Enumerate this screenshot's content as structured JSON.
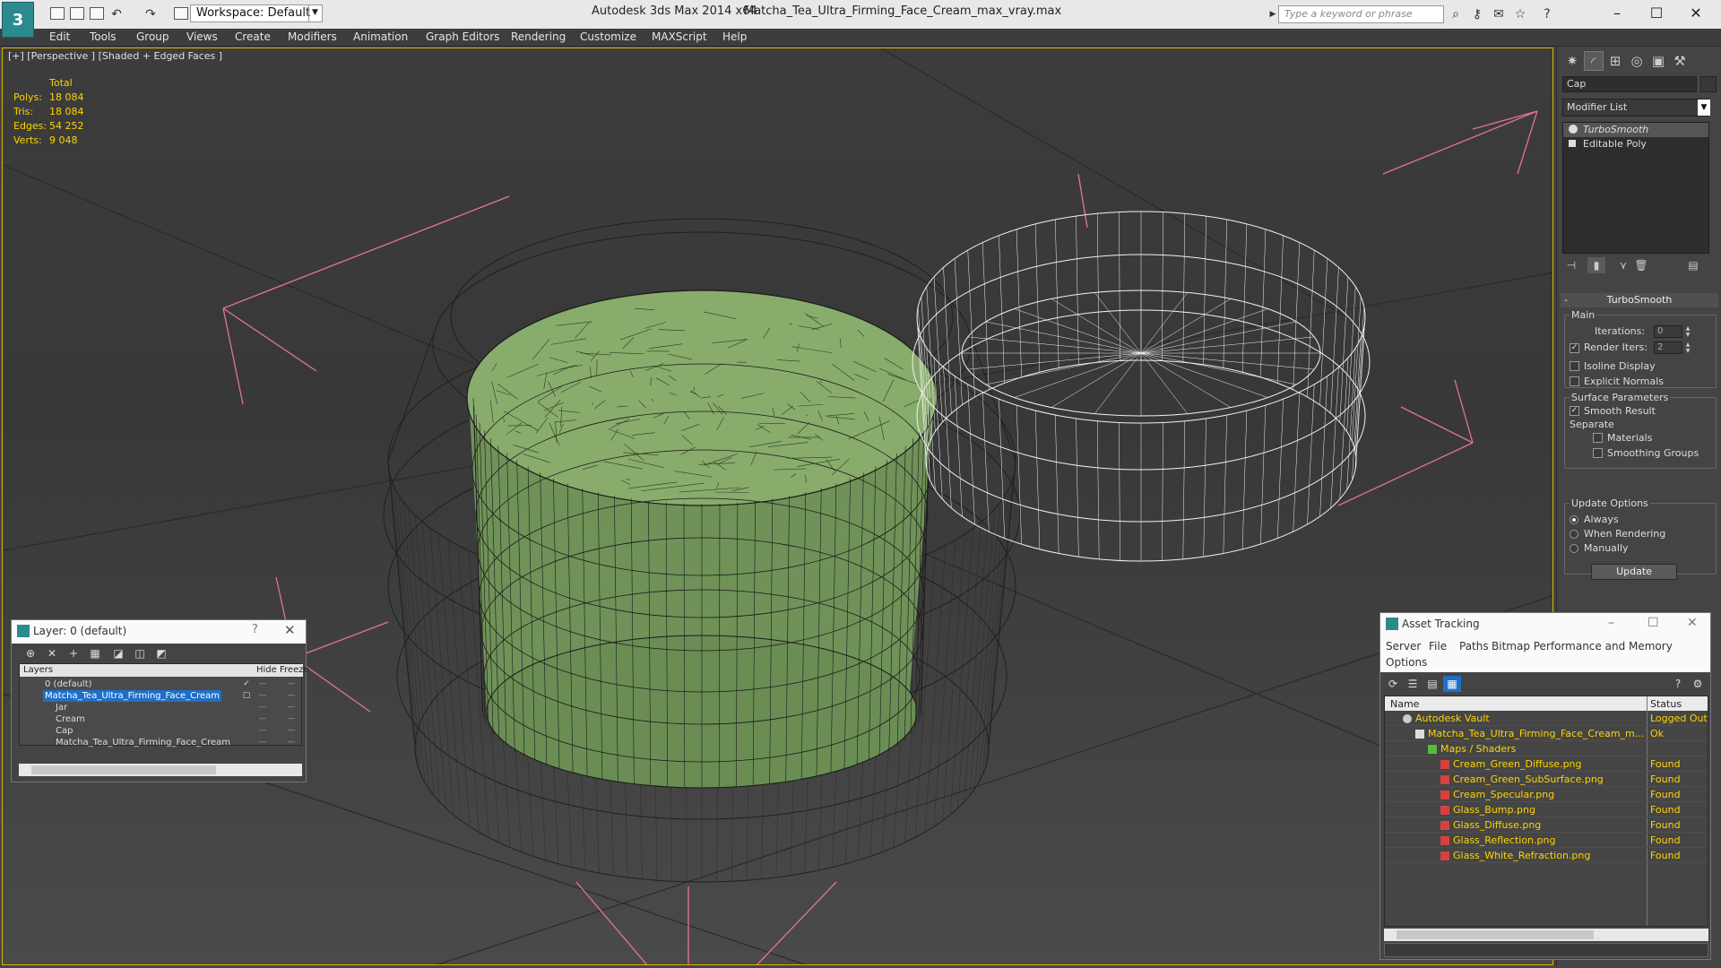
{
  "titlebar": {
    "workspace": "Workspace: Default",
    "app_title": "Autodesk 3ds Max  2014 x64",
    "file_title": "Matcha_Tea_Ultra_Firming_Face_Cream_max_vray.max",
    "search_placeholder": "Type a keyword or phrase"
  },
  "menu": [
    "Edit",
    "Tools",
    "Group",
    "Views",
    "Create",
    "Modifiers",
    "Animation",
    "Graph Editors",
    "Rendering",
    "Customize",
    "MAXScript",
    "Help"
  ],
  "viewport": {
    "label": "[+] [Perspective ] [Shaded + Edged Faces ]",
    "stats_header": "Total",
    "stats": [
      {
        "label": "Polys:",
        "value": "18 084"
      },
      {
        "label": "Tris:",
        "value": "18 084"
      },
      {
        "label": "Edges:",
        "value": "54 252"
      },
      {
        "label": "Verts:",
        "value": "9 048"
      }
    ]
  },
  "command_panel": {
    "object_name": "Cap",
    "modifier_list": "Modifier List",
    "stack": [
      "TurboSmooth",
      "Editable Poly"
    ],
    "rollout_title": "TurboSmooth",
    "main_label": "Main",
    "iterations_label": "Iterations:",
    "iterations_value": "0",
    "render_iters_label": "Render Iters:",
    "render_iters_value": "2",
    "isoline_label": "Isoline Display",
    "explicit_normals_label": "Explicit Normals",
    "surface_params_label": "Surface Parameters",
    "smooth_result_label": "Smooth Result",
    "separate_label": "Separate",
    "materials_label": "Materials",
    "smoothing_groups_label": "Smoothing Groups",
    "update_options_label": "Update Options",
    "always_label": "Always",
    "when_rendering_label": "When Rendering",
    "manually_label": "Manually",
    "update_button": "Update"
  },
  "layer_window": {
    "title": "Layer: 0 (default)",
    "col_layers": "Layers",
    "col_hide": "Hide",
    "col_freeze": "Freeze",
    "rows": [
      {
        "name": "0 (default)"
      },
      {
        "name": "Matcha_Tea_Ultra_Firming_Face_Cream"
      },
      {
        "name": "Jar"
      },
      {
        "name": "Cream"
      },
      {
        "name": "Cap"
      },
      {
        "name": "Matcha_Tea_Ultra_Firming_Face_Cream"
      }
    ]
  },
  "asset_window": {
    "title": "Asset Tracking",
    "menu": [
      "Server",
      "File",
      "Paths",
      "Bitmap Performance and Memory",
      "Options"
    ],
    "col_name": "Name",
    "col_status": "Status",
    "rows": [
      {
        "name": "Autodesk Vault",
        "status": "Logged Out"
      },
      {
        "name": "Matcha_Tea_Ultra_Firming_Face_Cream_m...",
        "status": "Ok"
      },
      {
        "name": "Maps / Shaders",
        "status": ""
      },
      {
        "name": "Cream_Green_Diffuse.png",
        "status": "Found"
      },
      {
        "name": "Cream_Green_SubSurface.png",
        "status": "Found"
      },
      {
        "name": "Cream_Specular.png",
        "status": "Found"
      },
      {
        "name": "Glass_Bump.png",
        "status": "Found"
      },
      {
        "name": "Glass_Diffuse.png",
        "status": "Found"
      },
      {
        "name": "Glass_Reflection.png",
        "status": "Found"
      },
      {
        "name": "Glass_White_Refraction.png",
        "status": "Found"
      }
    ]
  },
  "colors": {
    "accent": "#d8b400",
    "selection": "#1f6fc8",
    "cream": "#7c9e63",
    "stats": "#ffd400"
  }
}
